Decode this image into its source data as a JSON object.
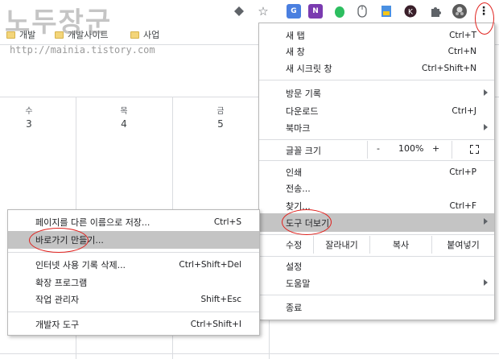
{
  "watermark": {
    "title": "노두장군",
    "url": "http://mainia.tistory.com"
  },
  "toolbar": {
    "icons": [
      "diamond-icon",
      "star-icon",
      "translate-icon",
      "onenote-icon",
      "evernote-icon",
      "mouse-icon",
      "download-icon",
      "k-icon",
      "puzzle-icon",
      "avatar",
      "more-icon"
    ]
  },
  "bookmarks": [
    {
      "label": "개발"
    },
    {
      "label": "개발사이트"
    },
    {
      "label": "사업"
    }
  ],
  "calendar": {
    "days": [
      {
        "name": "수",
        "date": "3"
      },
      {
        "name": "목",
        "date": "4"
      },
      {
        "name": "금",
        "date": "5"
      }
    ]
  },
  "menu": {
    "new_tab": "새 탭",
    "new_tab_sc": "Ctrl+T",
    "new_window": "새 창",
    "new_window_sc": "Ctrl+N",
    "incognito": "새 시크릿 창",
    "incognito_sc": "Ctrl+Shift+N",
    "history": "방문 기록",
    "downloads": "다운로드",
    "downloads_sc": "Ctrl+J",
    "bookmarks": "북마크",
    "zoom_label": "글꼴 크기",
    "zoom_minus": "-",
    "zoom_value": "100%",
    "zoom_plus": "+",
    "print": "인쇄",
    "print_sc": "Ctrl+P",
    "cast": "전송...",
    "find": "찾기...",
    "find_sc": "Ctrl+F",
    "more_tools": "도구 더보기",
    "edit": "수정",
    "cut": "잘라내기",
    "copy": "복사",
    "paste": "붙여넣기",
    "settings": "설정",
    "help": "도움말",
    "exit": "종료"
  },
  "submenu": {
    "save_as": "페이지를 다른 이름으로 저장...",
    "save_as_sc": "Ctrl+S",
    "create_shortcut": "바로가기 만들기...",
    "clear_data": "인터넷 사용 기록 삭제...",
    "clear_data_sc": "Ctrl+Shift+Del",
    "extensions": "확장 프로그램",
    "task_manager": "작업 관리자",
    "task_manager_sc": "Shift+Esc",
    "dev_tools": "개발자 도구",
    "dev_tools_sc": "Ctrl+Shift+I"
  },
  "colors": {
    "highlight": "#c4c4c4",
    "annotation": "#e0201c"
  }
}
